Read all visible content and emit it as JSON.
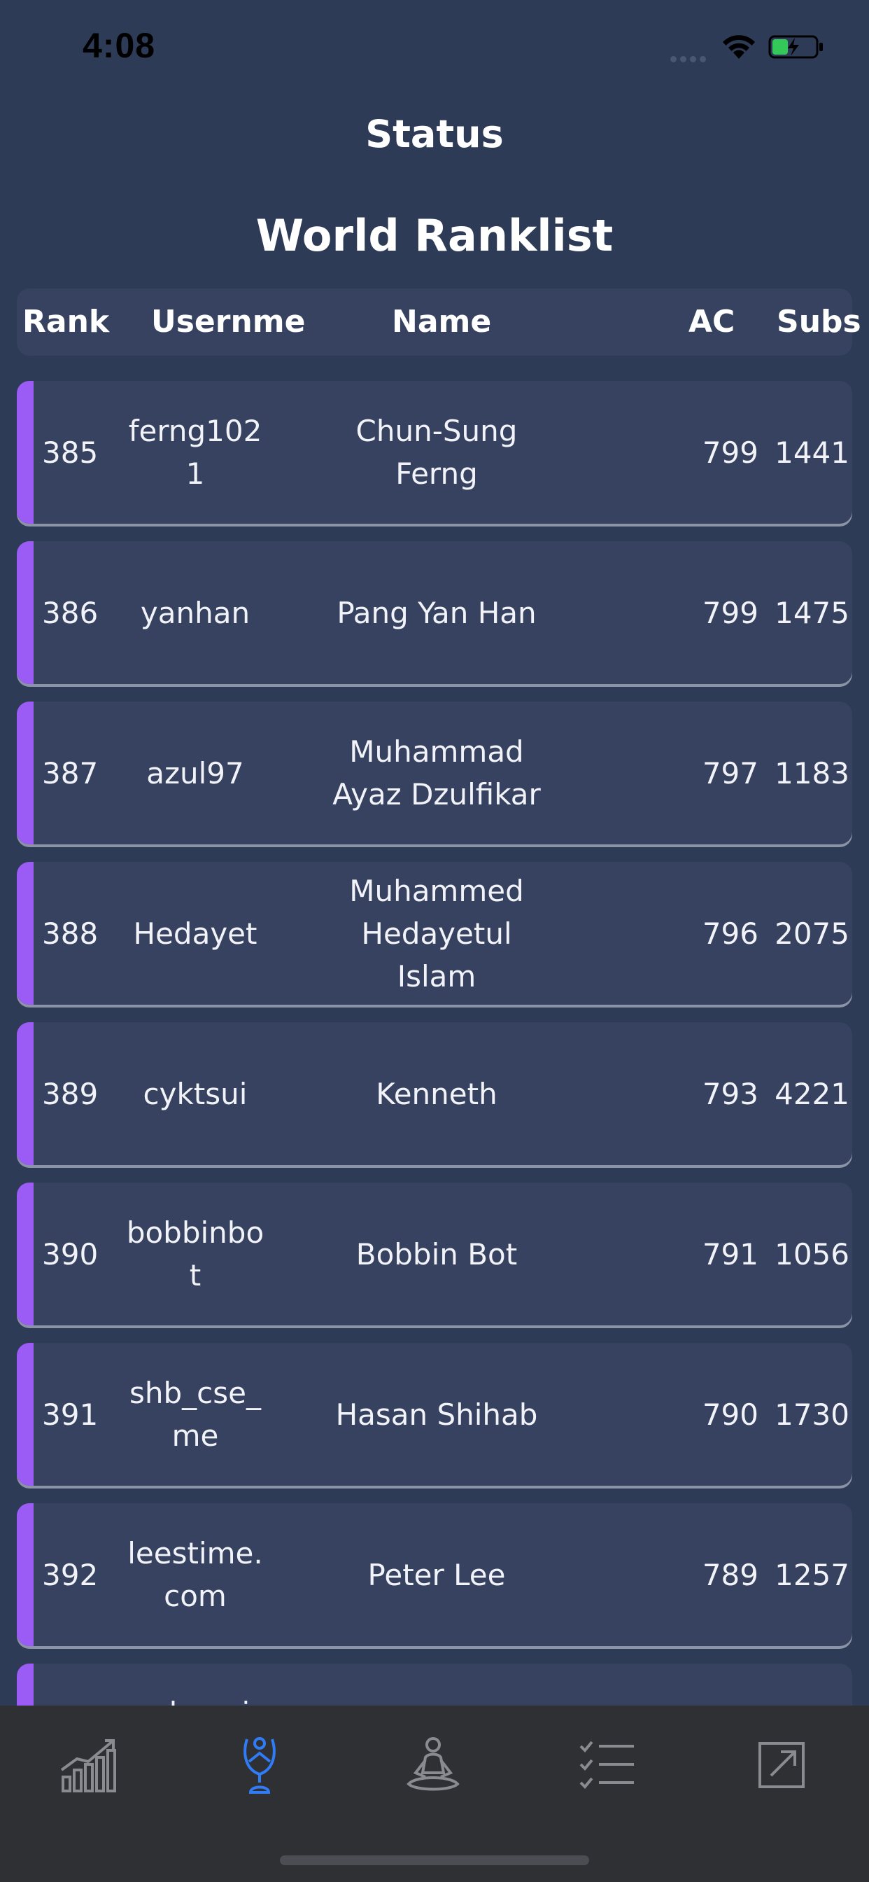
{
  "status_bar": {
    "time": "4:08"
  },
  "header": {
    "title": "Status",
    "subtitle": "World Ranklist"
  },
  "columns": {
    "rank": "Rank",
    "username": "Usernme",
    "name": "Name",
    "ac": "AC",
    "subs": "Subs"
  },
  "rows": [
    {
      "rank": "385",
      "username": "ferng1021",
      "name": "Chun-Sung Ferng",
      "ac": "799",
      "subs": "1441"
    },
    {
      "rank": "386",
      "username": "yanhan",
      "name": "Pang Yan Han",
      "ac": "799",
      "subs": "1475"
    },
    {
      "rank": "387",
      "username": "azul97",
      "name": "Muhammad Ayaz Dzulfikar",
      "ac": "797",
      "subs": "1183"
    },
    {
      "rank": "388",
      "username": "Hedayet",
      "name": "Muhammed Hedayetul Islam",
      "ac": "796",
      "subs": "2075"
    },
    {
      "rank": "389",
      "username": "cyktsui",
      "name": "Kenneth",
      "ac": "793",
      "subs": "4221"
    },
    {
      "rank": "390",
      "username": "bobbinbot",
      "name": "Bobbin Bot",
      "ac": "791",
      "subs": "1056"
    },
    {
      "rank": "391",
      "username": "shb_cse_me",
      "name": "Hasan Shihab",
      "ac": "790",
      "subs": "1730"
    },
    {
      "rank": "392",
      "username": "leestime.com",
      "name": "Peter Lee",
      "ac": "789",
      "subs": "1257"
    },
    {
      "rank": "",
      "username": "adaomi",
      "name": "",
      "ac": "",
      "subs": ""
    }
  ],
  "tabs": [
    {
      "icon": "bar-chart-icon",
      "active": false
    },
    {
      "icon": "trophy-icon",
      "active": true
    },
    {
      "icon": "meditation-icon",
      "active": false
    },
    {
      "icon": "checklist-icon",
      "active": false
    },
    {
      "icon": "external-link-icon",
      "active": false
    }
  ],
  "colors": {
    "background": "#2e3b57",
    "card": "#36425f",
    "accent": "#9b5cf6",
    "tab_active": "#2f7cf6",
    "tab_inactive": "#8a8b90"
  }
}
